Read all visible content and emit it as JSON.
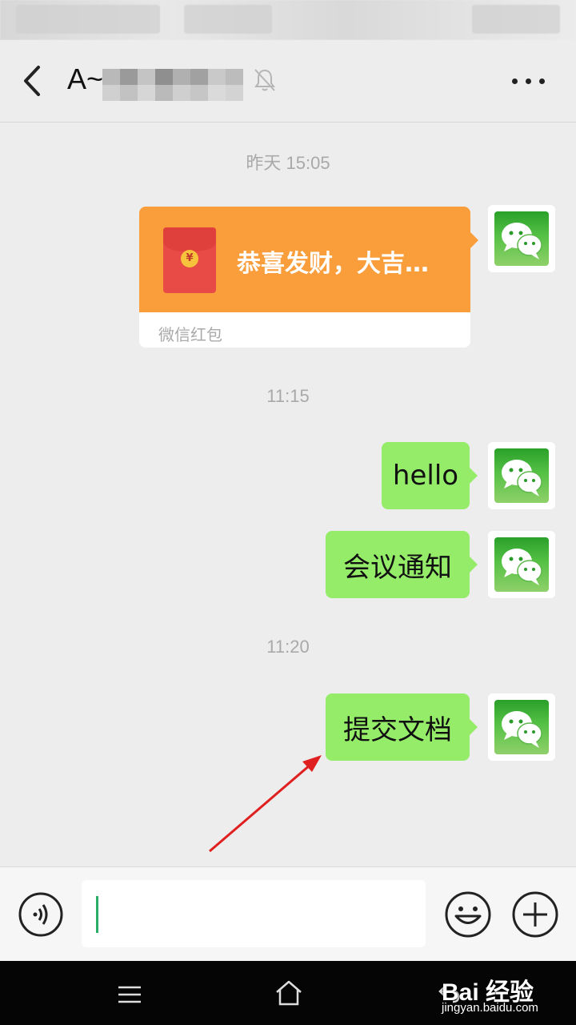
{
  "header": {
    "title": "A~",
    "back_icon": "chevron-left-icon",
    "mute_icon": "bell-off-icon",
    "more_icon": "more-dots-icon"
  },
  "messages": {
    "time1": "昨天 15:05",
    "red_packet": {
      "text": "恭喜发财，大吉…",
      "footer": "微信红包",
      "coin": "¥"
    },
    "time2": "11:15",
    "msg1": "hello",
    "msg2": "会议通知",
    "time3": "11:20",
    "msg3": "提交文档"
  },
  "input_bar": {
    "voice_icon": "voice-icon",
    "emoji_icon": "emoji-icon",
    "plus_icon": "plus-icon"
  },
  "watermark": {
    "main": "Bai 经验",
    "sub": "jingyan.baidu.com"
  },
  "colors": {
    "bubble_green": "#95ec69",
    "red_packet_orange": "#fa9d3b",
    "arrow_red": "#e02020"
  }
}
